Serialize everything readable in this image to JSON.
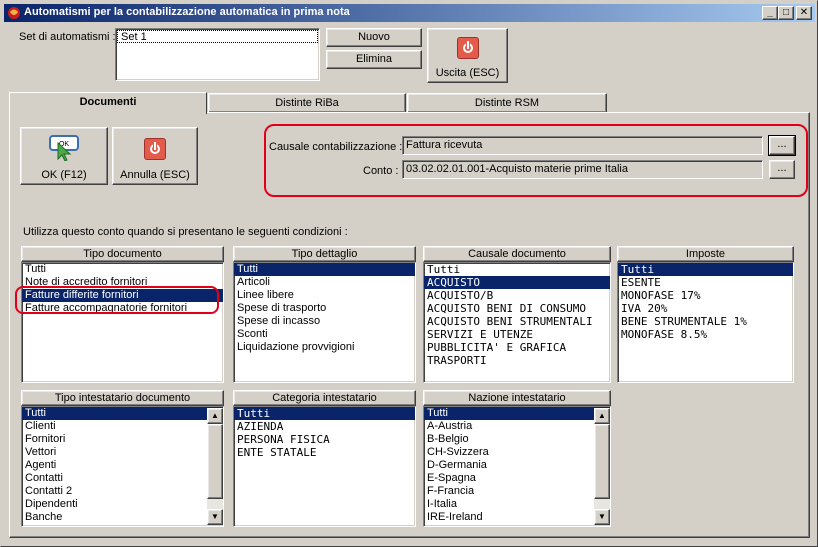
{
  "window": {
    "title": "Automatismi per la contabilizzazione automatica in prima nota",
    "minimize": "_",
    "maximize": "□",
    "close": "✕"
  },
  "top": {
    "set_label": "Set di automatismi :",
    "set_items": [
      "Set 1"
    ],
    "nuovo_label": "Nuovo",
    "elimina_label": "Elimina",
    "uscita_label": "Uscita (ESC)"
  },
  "tabs": [
    "Documenti",
    "Distinte RiBa",
    "Distinte RSM"
  ],
  "documenti": {
    "ok_label": "OK (F12)",
    "ok_icon_text": "OK",
    "annulla_label": "Annulla (ESC)",
    "causale_label": "Causale contabilizzazione :",
    "causale_value": "Fattura ricevuta",
    "conto_label": "Conto :",
    "conto_value": "03.02.02.01.001-Acquisto materie prime Italia",
    "ellipsis": "...",
    "conditions_text": "Utilizza questo conto quando si presentano le seguenti condizioni :"
  },
  "panels": {
    "tipo_documento": {
      "header": "Tipo documento",
      "items": [
        "Tutti",
        "Note di accredito fornitori",
        "Fatture differite fornitori",
        "Fatture accompagnatorie fornitori"
      ],
      "selected": 2
    },
    "tipo_dettaglio": {
      "header": "Tipo dettaglio",
      "items": [
        "Tutti",
        "Articoli",
        "Linee libere",
        "Spese di trasporto",
        "Spese di incasso",
        "Sconti",
        "Liquidazione provvigioni"
      ],
      "selected": 0
    },
    "causale_documento": {
      "header": "Causale documento",
      "items": [
        "Tutti",
        "ACQUISTO",
        "ACQUISTO/B",
        "ACQUISTO BENI DI CONSUMO",
        "ACQUISTO BENI STRUMENTALI",
        "SERVIZI E UTENZE",
        "PUBBLICITA' E GRAFICA",
        "TRASPORTI"
      ],
      "selected": 1
    },
    "imposte": {
      "header": "Imposte",
      "items": [
        "Tutti",
        "ESENTE",
        "MONOFASE 17%",
        "IVA 20%",
        "BENE STRUMENTALE 1%",
        "MONOFASE 8.5%"
      ],
      "selected": 0
    },
    "tipo_intestatario": {
      "header": "Tipo intestatario documento",
      "items": [
        "Tutti",
        "Clienti",
        "Fornitori",
        "Vettori",
        "Agenti",
        "Contatti",
        "Contatti 2",
        "Dipendenti",
        "Banche"
      ],
      "selected": 0
    },
    "categoria_intestatario": {
      "header": "Categoria intestatario",
      "items": [
        "Tutti",
        "AZIENDA",
        "PERSONA FISICA",
        "ENTE STATALE"
      ],
      "selected": 0
    },
    "nazione_intestatario": {
      "header": "Nazione intestatario",
      "items": [
        "Tutti",
        "A-Austria",
        "B-Belgio",
        "CH-Svizzera",
        "D-Germania",
        "E-Spagna",
        "F-Francia",
        "I-Italia",
        "IRE-Ireland"
      ],
      "selected": 0
    }
  },
  "colors": {
    "highlight": "#e0001a",
    "selection": "#0a246a",
    "face": "#d4d0c8"
  }
}
